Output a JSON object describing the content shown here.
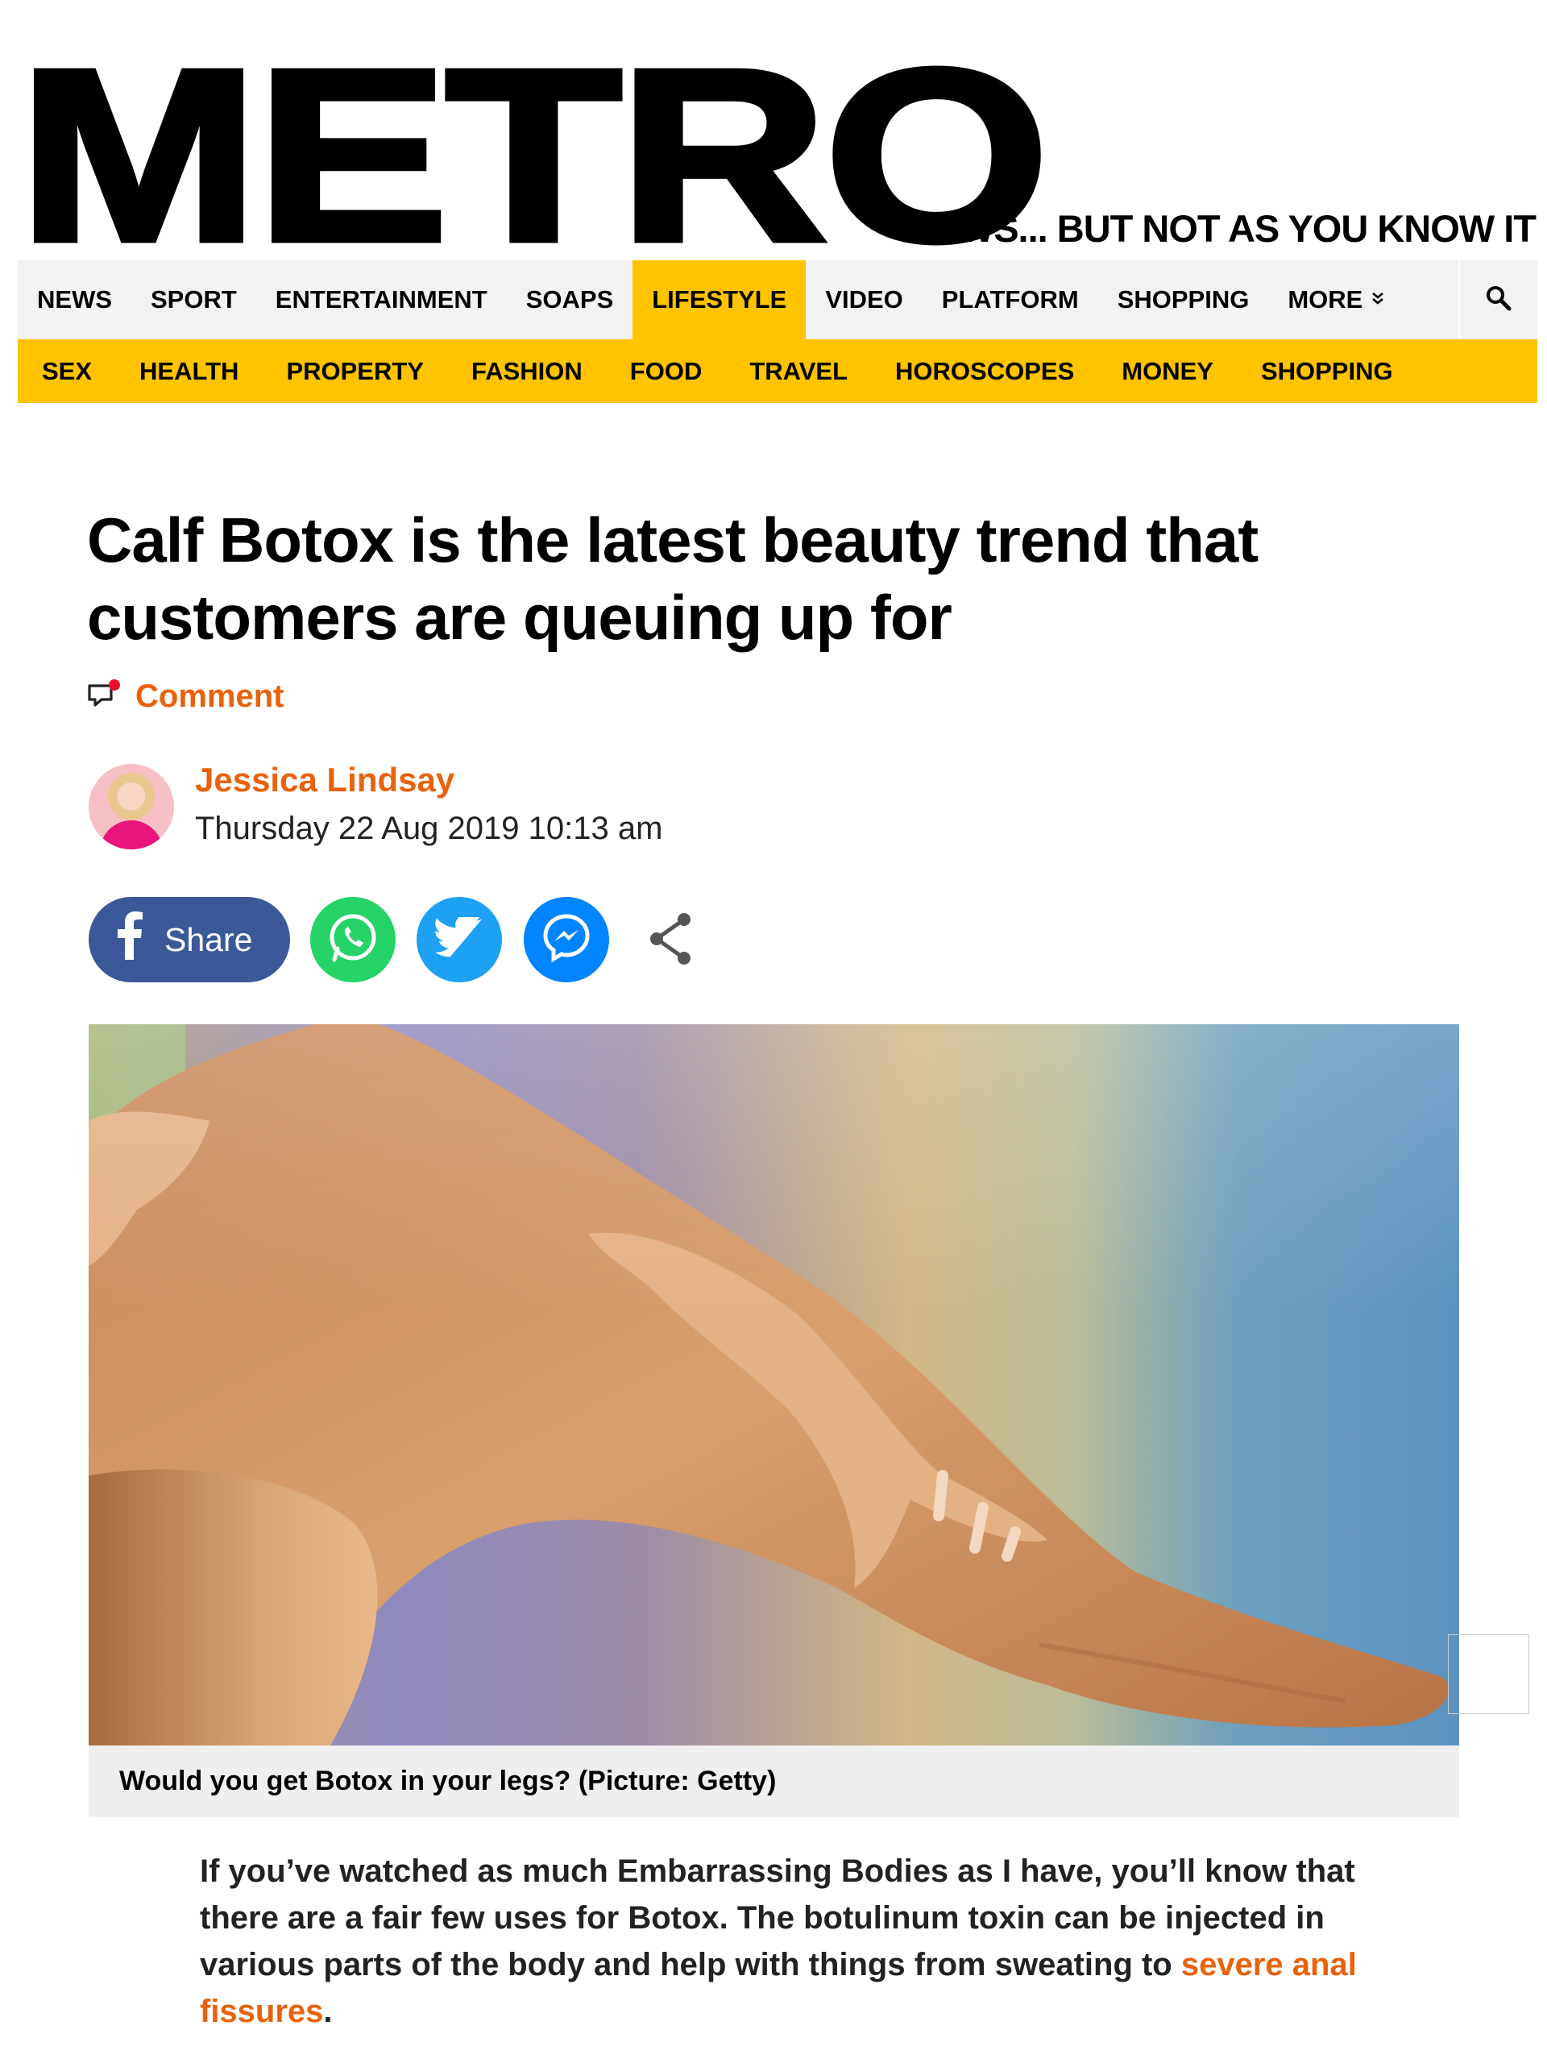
{
  "brand": {
    "logo": "METRO",
    "tagline": "NEWS... BUT NOT AS YOU KNOW IT"
  },
  "nav": {
    "items": [
      "NEWS",
      "SPORT",
      "ENTERTAINMENT",
      "SOAPS",
      "LIFESTYLE",
      "VIDEO",
      "PLATFORM",
      "SHOPPING"
    ],
    "active": "LIFESTYLE",
    "more_label": "MORE",
    "search_icon": "search-icon"
  },
  "subnav": {
    "items": [
      "SEX",
      "HEALTH",
      "PROPERTY",
      "FASHION",
      "FOOD",
      "TRAVEL",
      "HOROSCOPES",
      "MONEY",
      "SHOPPING"
    ]
  },
  "article": {
    "headline": "Calf Botox is the latest beauty trend that customers are queuing up for",
    "comment_label": "Comment",
    "author": "Jessica Lindsay",
    "date": "Thursday 22 Aug 2019 10:13 am",
    "share_label": "Share",
    "caption": "Would you get Botox in your legs? (Picture: Getty)",
    "intro_text": "If you’ve watched as much Embarrassing Bodies as I have, you’ll know that there are a fair few uses for Botox. The botulinum toxin can be injected in various parts of the body and help with things from sweating to ",
    "intro_link": "severe anal fissures",
    "intro_end": "."
  },
  "colors": {
    "accent": "#e8620c",
    "nav_yellow": "#ffc300",
    "facebook": "#3b5998",
    "whatsapp": "#25d366",
    "twitter": "#1da1f2",
    "messenger": "#0084ff"
  }
}
